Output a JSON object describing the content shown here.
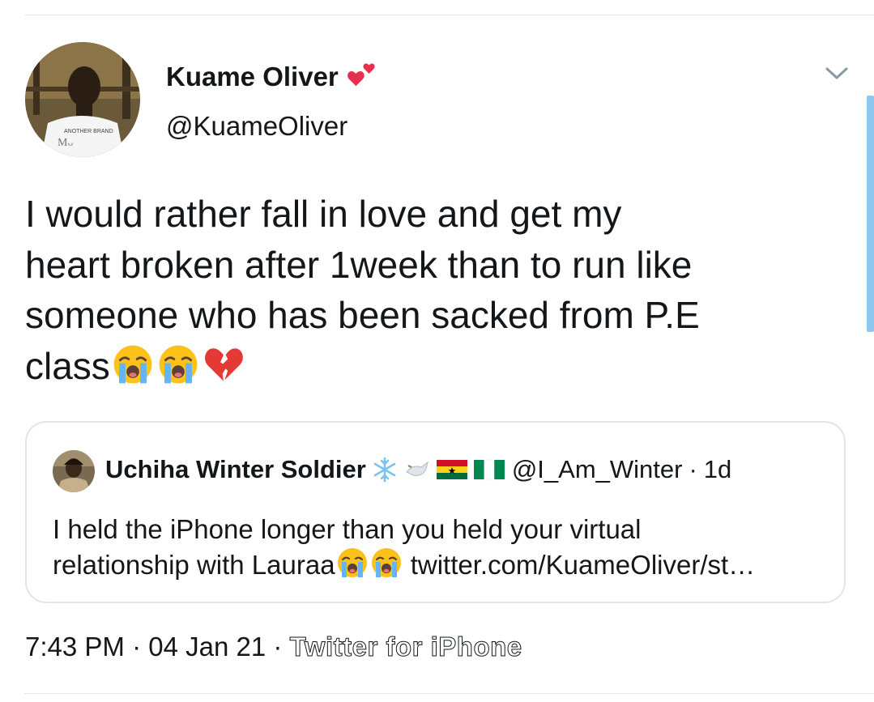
{
  "author": {
    "name": "Kuame Oliver",
    "handle": "@KuameOliver",
    "name_emoji": "two-hearts-icon"
  },
  "tweet": {
    "lines": [
      "I would rather fall in love and get my",
      "heart broken after 1week  than to run like",
      "someone who has been sacked from P.E",
      "class"
    ],
    "trailing_emojis": [
      "loudly-crying-face-icon",
      "loudly-crying-face-icon",
      "broken-heart-icon"
    ]
  },
  "quoted_tweet": {
    "name": "Uchiha Winter Soldier",
    "name_emojis": [
      "snowflake-icon",
      "dove-icon",
      "ghana-flag-icon",
      "nigeria-flag-icon"
    ],
    "handle": "@I_Am_Winter",
    "separator": "·",
    "age": "1d",
    "line1": "I held the iPhone longer than you held your virtual",
    "line2_prefix": "relationship with Lauraa",
    "line2_link": "twitter.com/KuameOliver/st…"
  },
  "meta": {
    "time": "7:43 PM",
    "separator": "·",
    "date": "04 Jan 21",
    "separator2": "·",
    "source": "Twitter for iPhone"
  },
  "colors": {
    "text": "#14171a",
    "divider": "#e1e8ed",
    "quote_border": "#dfe6ea",
    "scrollbar": "#8ec8f0",
    "chevron": "#8899a6"
  }
}
